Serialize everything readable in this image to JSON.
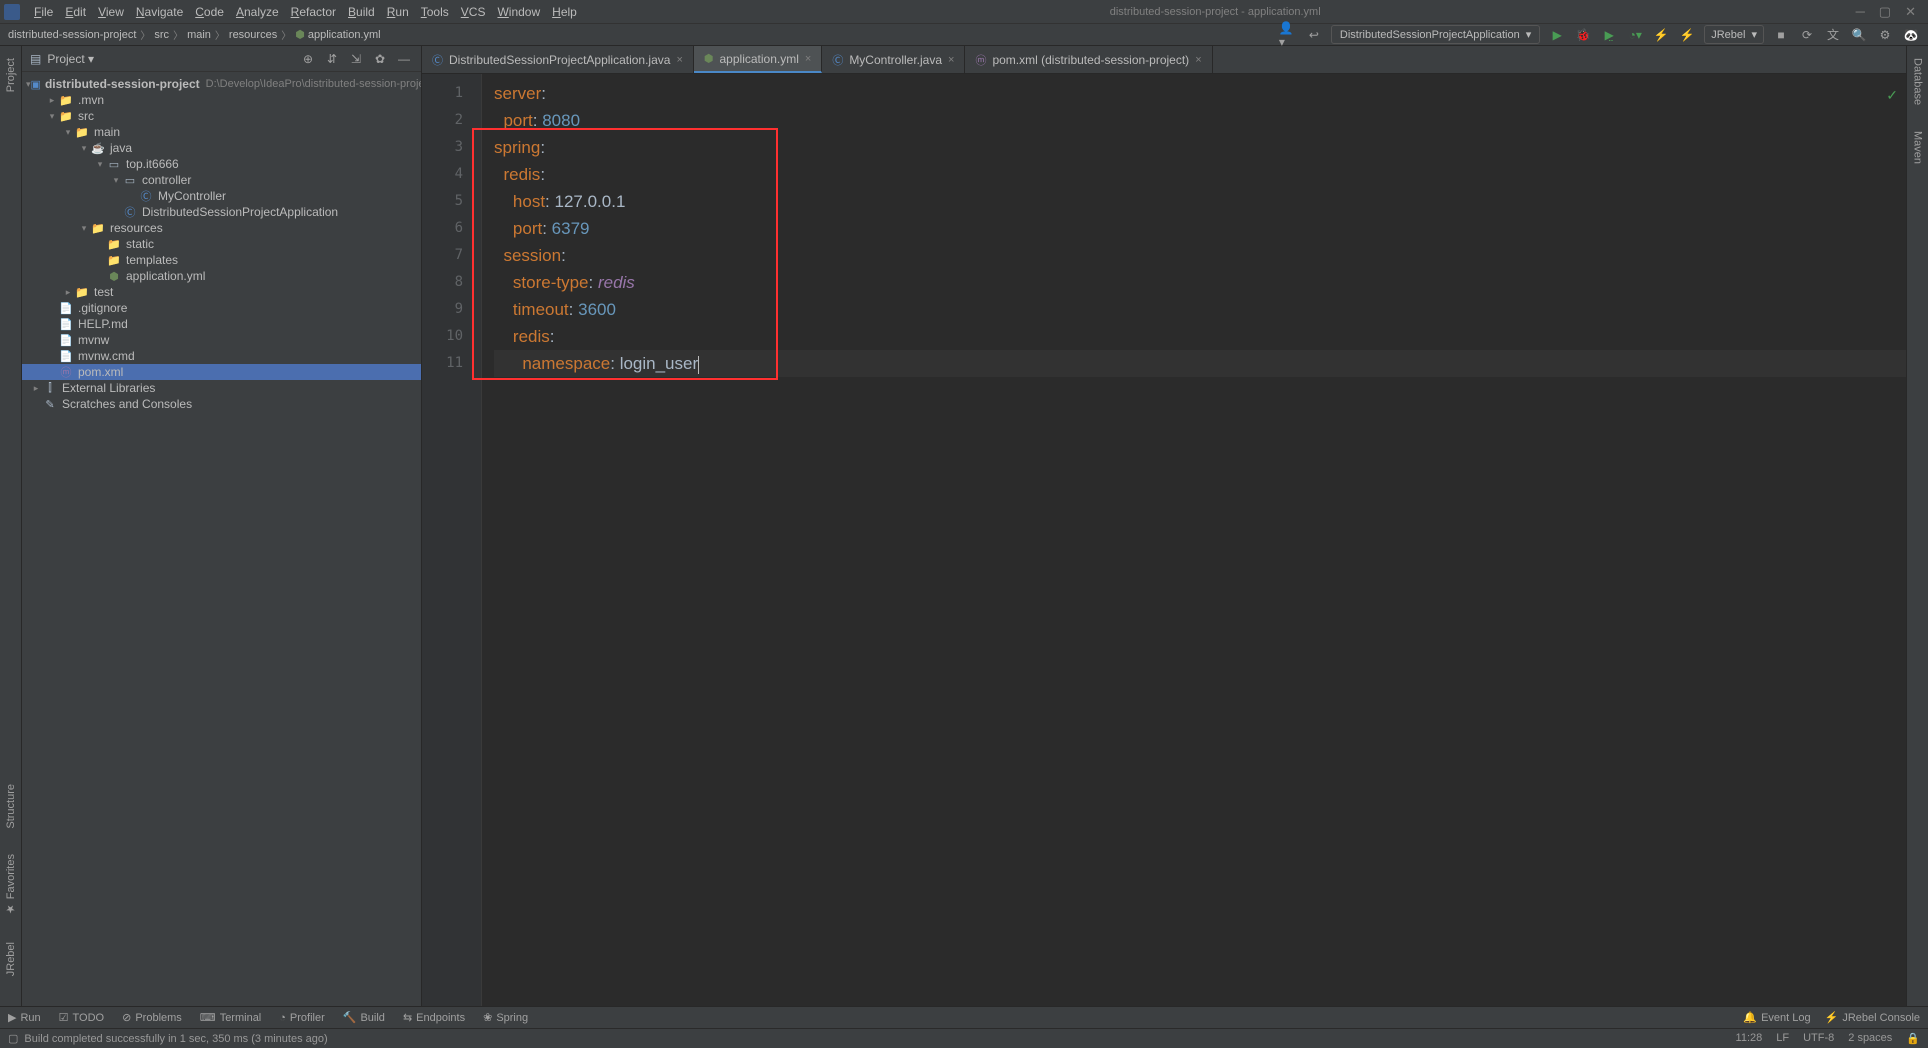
{
  "title": "distributed-session-project - application.yml",
  "menu": [
    "File",
    "Edit",
    "View",
    "Navigate",
    "Code",
    "Analyze",
    "Refactor",
    "Build",
    "Run",
    "Tools",
    "VCS",
    "Window",
    "Help"
  ],
  "breadcrumb": [
    "distributed-session-project",
    "src",
    "main",
    "resources",
    "application.yml"
  ],
  "run_config": "DistributedSessionProjectApplication",
  "jrebel_label": "JRebel",
  "project_panel": {
    "title": "Project",
    "tree": [
      {
        "depth": 0,
        "caret": "v",
        "icon": "module",
        "label": "distributed-session-project",
        "hint": "D:\\Develop\\IdeaPro\\distributed-session-project",
        "bold": true
      },
      {
        "depth": 1,
        "caret": ">",
        "icon": "folder",
        "label": ".mvn"
      },
      {
        "depth": 1,
        "caret": "v",
        "icon": "folder",
        "label": "src"
      },
      {
        "depth": 2,
        "caret": "v",
        "icon": "folder",
        "label": "main"
      },
      {
        "depth": 3,
        "caret": "v",
        "icon": "java",
        "label": "java"
      },
      {
        "depth": 4,
        "caret": "v",
        "icon": "package",
        "label": "top.it6666"
      },
      {
        "depth": 5,
        "caret": "v",
        "icon": "package",
        "label": "controller"
      },
      {
        "depth": 6,
        "caret": "",
        "icon": "class",
        "label": "MyController"
      },
      {
        "depth": 5,
        "caret": "",
        "icon": "class",
        "label": "DistributedSessionProjectApplication"
      },
      {
        "depth": 3,
        "caret": "v",
        "icon": "resources",
        "label": "resources"
      },
      {
        "depth": 4,
        "caret": "",
        "icon": "folder",
        "label": "static"
      },
      {
        "depth": 4,
        "caret": "",
        "icon": "folder",
        "label": "templates"
      },
      {
        "depth": 4,
        "caret": "",
        "icon": "yml",
        "label": "application.yml"
      },
      {
        "depth": 2,
        "caret": ">",
        "icon": "folder",
        "label": "test"
      },
      {
        "depth": 1,
        "caret": "",
        "icon": "file",
        "label": ".gitignore"
      },
      {
        "depth": 1,
        "caret": "",
        "icon": "file",
        "label": "HELP.md"
      },
      {
        "depth": 1,
        "caret": "",
        "icon": "file",
        "label": "mvnw"
      },
      {
        "depth": 1,
        "caret": "",
        "icon": "file",
        "label": "mvnw.cmd"
      },
      {
        "depth": 1,
        "caret": "",
        "icon": "pom",
        "label": "pom.xml",
        "selected": true
      },
      {
        "depth": 0,
        "caret": ">",
        "icon": "lib",
        "label": "External Libraries"
      },
      {
        "depth": 0,
        "caret": "",
        "icon": "scratch",
        "label": "Scratches and Consoles"
      }
    ]
  },
  "tabs": [
    {
      "icon": "class",
      "label": "DistributedSessionProjectApplication.java",
      "active": false
    },
    {
      "icon": "yml",
      "label": "application.yml",
      "active": true
    },
    {
      "icon": "class",
      "label": "MyController.java",
      "active": false
    },
    {
      "icon": "pom",
      "label": "pom.xml (distributed-session-project)",
      "active": false
    }
  ],
  "code_lines": [
    [
      {
        "c": "k",
        "t": "server"
      },
      {
        "c": "t",
        "t": ":"
      }
    ],
    [
      {
        "c": "t",
        "t": "  "
      },
      {
        "c": "k",
        "t": "port"
      },
      {
        "c": "t",
        "t": ": "
      },
      {
        "c": "v",
        "t": "8080"
      }
    ],
    [
      {
        "c": "k",
        "t": "spring"
      },
      {
        "c": "t",
        "t": ":"
      }
    ],
    [
      {
        "c": "t",
        "t": "  "
      },
      {
        "c": "k",
        "t": "redis"
      },
      {
        "c": "t",
        "t": ":"
      }
    ],
    [
      {
        "c": "t",
        "t": "    "
      },
      {
        "c": "k",
        "t": "host"
      },
      {
        "c": "t",
        "t": ": "
      },
      {
        "c": "t",
        "t": "127.0.0.1"
      }
    ],
    [
      {
        "c": "t",
        "t": "    "
      },
      {
        "c": "k",
        "t": "port"
      },
      {
        "c": "t",
        "t": ": "
      },
      {
        "c": "v",
        "t": "6379"
      }
    ],
    [
      {
        "c": "t",
        "t": "  "
      },
      {
        "c": "k",
        "t": "session"
      },
      {
        "c": "t",
        "t": ":"
      }
    ],
    [
      {
        "c": "t",
        "t": "    "
      },
      {
        "c": "k",
        "t": "store-type"
      },
      {
        "c": "t",
        "t": ": "
      },
      {
        "c": "i",
        "t": "redis"
      }
    ],
    [
      {
        "c": "t",
        "t": "    "
      },
      {
        "c": "k",
        "t": "timeout"
      },
      {
        "c": "t",
        "t": ": "
      },
      {
        "c": "v",
        "t": "3600"
      }
    ],
    [
      {
        "c": "t",
        "t": "    "
      },
      {
        "c": "k",
        "t": "redis"
      },
      {
        "c": "t",
        "t": ":"
      }
    ],
    [
      {
        "c": "t",
        "t": "      "
      },
      {
        "c": "k",
        "t": "namespace"
      },
      {
        "c": "t",
        "t": ": "
      },
      {
        "c": "t",
        "t": "login_user"
      }
    ]
  ],
  "current_line": 11,
  "left_gutter": [
    {
      "label": "Project"
    }
  ],
  "left_gutter_bottom": [
    {
      "label": "Structure"
    },
    {
      "label": "Favorites"
    },
    {
      "label": "JRebel"
    }
  ],
  "right_gutter": [
    {
      "label": "Database"
    },
    {
      "label": "Maven"
    }
  ],
  "bottom_tabs": [
    "Run",
    "TODO",
    "Problems",
    "Terminal",
    "Profiler",
    "Build",
    "Endpoints",
    "Spring"
  ],
  "bottom_right": [
    "Event Log",
    "JRebel Console"
  ],
  "status": {
    "msg": "Build completed successfully in 1 sec, 350 ms (3 minutes ago)",
    "pos": "11:28",
    "sep": "LF",
    "enc": "UTF-8",
    "indent": "2 spaces"
  }
}
